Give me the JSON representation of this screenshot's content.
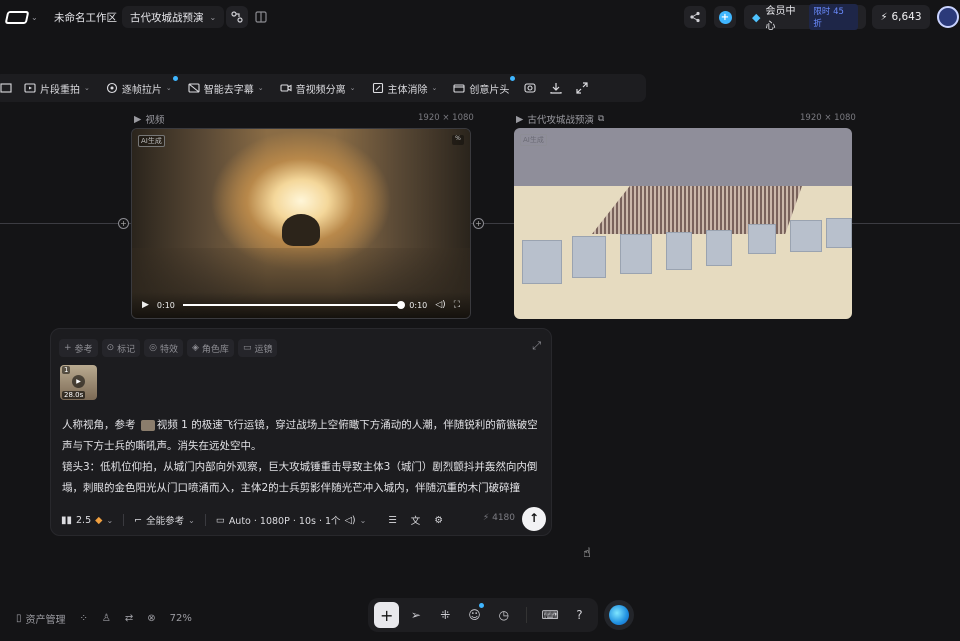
{
  "topbar": {
    "workspace": "未命名工作区",
    "project": "古代攻城战预演",
    "vip_label": "会员中心",
    "vip_badge": "限时 45 折",
    "credits": "6,643"
  },
  "toolbar": {
    "items": [
      {
        "label": "片段重拍"
      },
      {
        "label": "逐帧拉片"
      },
      {
        "label": "智能去字幕"
      },
      {
        "label": "音视频分离"
      },
      {
        "label": "主体消除"
      },
      {
        "label": "创意片头"
      }
    ]
  },
  "nodes": {
    "video": {
      "title": "视频",
      "dims": "1920 × 1080",
      "ai_tag": "AI生成",
      "time_current": "0:10",
      "time_total": "0:10",
      "progress": 1.0
    },
    "battle": {
      "title": "古代攻城战预演",
      "dims": "1920 × 1080",
      "ai_tag": "AI生成"
    }
  },
  "prompt": {
    "chips": [
      "参考",
      "标记",
      "特效",
      "角色库",
      "运镜"
    ],
    "thumb_index": "1",
    "thumb_duration": "28.0s",
    "text_before": "人称视角，参考",
    "ref_label": "视频 1",
    "text_after": "的极速飞行运镜，穿过战场上空俯瞰下方涌动的人潮，伴随锐利的箭镞破空声与下方士兵的嘶吼声。消失在远处空中。",
    "line2": "镜头3：低机位仰拍，从城门内部向外观察，巨大攻城锤重击导致主体3（城门）剧烈颤抖并轰然向内倒塌，刺眼的金色阳光从门口喷涌而入，主体2的士兵剪影伴随光芒冲入城内，伴随沉重的木门破碎撞",
    "model": "2.5",
    "mode": "全能参考",
    "settings": "Auto · 1080P · 10s · 1个",
    "cost": "4180"
  },
  "bottom": {
    "assets": "资产管理",
    "zoom": "72%"
  },
  "colors": {
    "accent_blue": "#3fb6ff",
    "background": "#141416",
    "panel": "#1c1c1f"
  }
}
